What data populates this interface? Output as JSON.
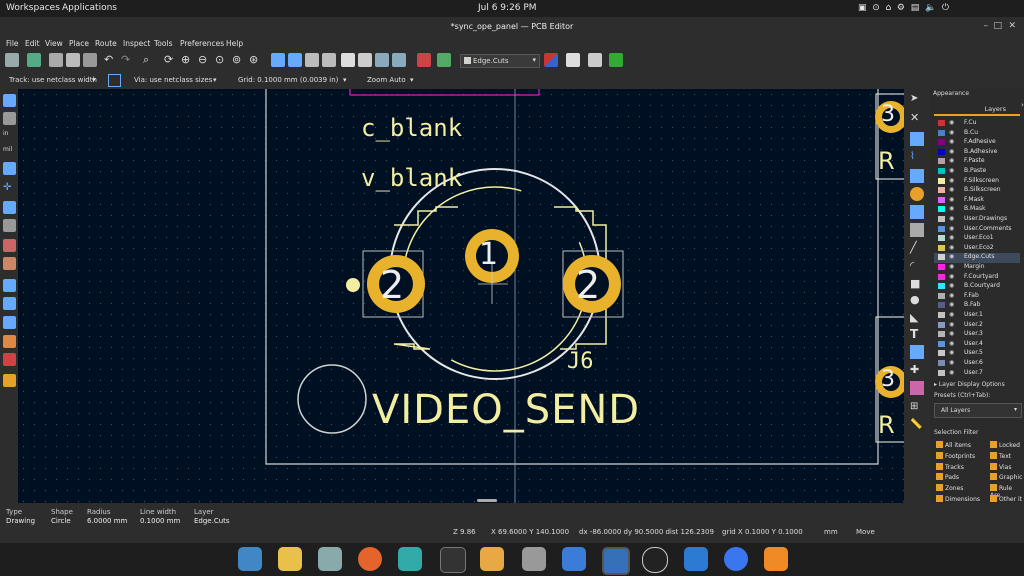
{
  "topbar": {
    "workspaces": "Workspaces",
    "applications": "Applications",
    "clock": "Jul 6   9:26 PM"
  },
  "window": {
    "title": "*sync_ope_panel — PCB Editor"
  },
  "menu": [
    "File",
    "Edit",
    "View",
    "Place",
    "Route",
    "Inspect",
    "Tools",
    "Preferences",
    "Help"
  ],
  "toolbar": {
    "layer_select": "Edge.Cuts"
  },
  "options": {
    "track": "Track: use netclass width",
    "via": "Via: use netclass sizes",
    "grid": "Grid: 0.1000 mm (0.0039 in)",
    "zoom": "Zoom Auto"
  },
  "canvas": {
    "text_c_blank": "c_blank",
    "text_v_blank": "v_blank",
    "text_video_send": "VIDEO_SEND",
    "ref_j6": "J6",
    "pad1": "1",
    "pad2a": "2",
    "pad2b": "2",
    "edge_pad_top": "3",
    "edge_pad_bottom": "3",
    "edge_r_top": "R",
    "edge_r_bottom": "R"
  },
  "panel": {
    "title": "Appearance",
    "tab_layers": "Layers",
    "layers": [
      {
        "name": "F.Cu",
        "color": "#c83434"
      },
      {
        "name": "B.Cu",
        "color": "#4d7fc4"
      },
      {
        "name": "F.Adhesive",
        "color": "#84007c"
      },
      {
        "name": "B.Adhesive",
        "color": "#0000c8"
      },
      {
        "name": "F.Paste",
        "color": "#b4a0a0"
      },
      {
        "name": "B.Paste",
        "color": "#00c2c2"
      },
      {
        "name": "F.Silkscreen",
        "color": "#f2eda1"
      },
      {
        "name": "B.Silkscreen",
        "color": "#e8b2a7"
      },
      {
        "name": "F.Mask",
        "color": "#d864ff"
      },
      {
        "name": "B.Mask",
        "color": "#02ffee"
      },
      {
        "name": "User.Drawings",
        "color": "#c2c2c2"
      },
      {
        "name": "User.Comments",
        "color": "#5994dc"
      },
      {
        "name": "User.Eco1",
        "color": "#b4dbd2"
      },
      {
        "name": "User.Eco2",
        "color": "#d8c852"
      },
      {
        "name": "Edge.Cuts",
        "color": "#d0d2cd"
      },
      {
        "name": "Margin",
        "color": "#ff26e2"
      },
      {
        "name": "F.Courtyard",
        "color": "#ff26e2"
      },
      {
        "name": "B.Courtyard",
        "color": "#26e9ff"
      },
      {
        "name": "F.Fab",
        "color": "#afafaf"
      },
      {
        "name": "B.Fab",
        "color": "#585d84"
      },
      {
        "name": "User.1",
        "color": "#c2c2c2"
      },
      {
        "name": "User.2",
        "color": "#8999c2"
      },
      {
        "name": "User.3",
        "color": "#b4b4b4"
      },
      {
        "name": "User.4",
        "color": "#5994dc"
      },
      {
        "name": "User.5",
        "color": "#c8c8c8"
      },
      {
        "name": "User.6",
        "color": "#7d8bb0"
      },
      {
        "name": "User.7",
        "color": "#c2c2c2"
      }
    ],
    "layer_display_options": "Layer Display Options",
    "presets_label": "Presets (Ctrl+Tab):",
    "presets_value": "All Layers",
    "selection_filter_title": "Selection Filter",
    "filters": [
      "All items",
      "Locked",
      "Footprints",
      "Text",
      "Tracks",
      "Vias",
      "Pads",
      "Graphic",
      "Zones",
      "Rule Are",
      "Dimensions",
      "Other it"
    ]
  },
  "status": {
    "h_type": "Type",
    "v_type": "Drawing",
    "h_shape": "Shape",
    "v_shape": "Circle",
    "h_radius": "Radius",
    "v_radius": "6.0000 mm",
    "h_linewidth": "Line width",
    "v_linewidth": "0.1000 mm",
    "h_layer": "Layer",
    "v_layer": "Edge.Cuts",
    "z": "Z 9.86",
    "xy": "X 69.6000  Y 140.1000",
    "dxdy": "dx -86.0000  dy 90.5000  dist 126.2309",
    "grid": "grid X 0.1000  Y 0.1000",
    "units": "mm",
    "mode": "Move"
  },
  "colors": {
    "canvas_bg": "#001023",
    "pad_gold": "#e8b22c",
    "silk": "#f2eda1",
    "edge": "#d0d2cd",
    "accent": "#e8a02c"
  }
}
